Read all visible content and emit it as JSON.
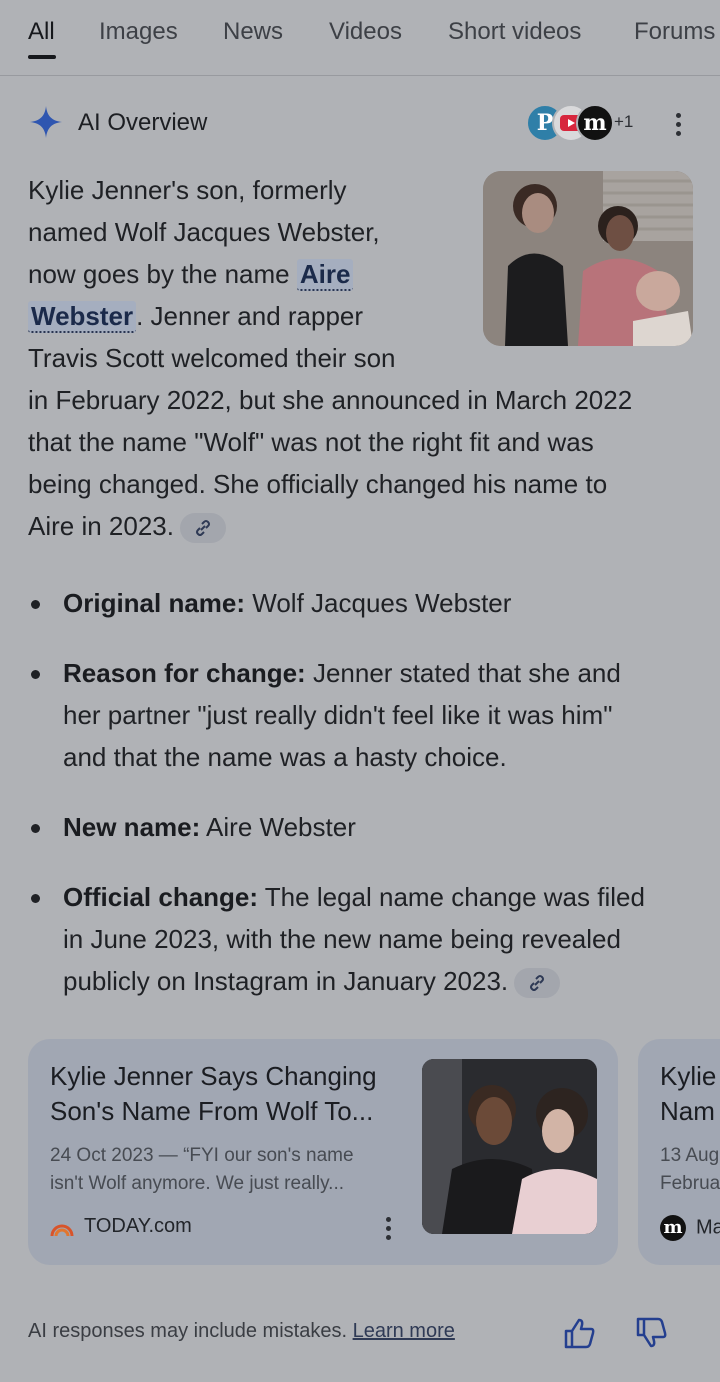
{
  "tabs": [
    {
      "label": "All",
      "active": true
    },
    {
      "label": "Images"
    },
    {
      "label": "News"
    },
    {
      "label": "Videos"
    },
    {
      "label": "Short videos"
    },
    {
      "label": "Forums"
    }
  ],
  "ai_overview": {
    "title": "AI Overview",
    "sources_more": "+1",
    "paragraph_lines": [
      "Kylie Jenner's son, formerly",
      "named Wolf Jacques Webster,",
      "now goes by the name ",
      "Aire",
      "Webster",
      ". Jenner and rapper",
      "Travis Scott welcomed their son",
      "in February 2022, but she announced in March 2022",
      "that the name \"Wolf\" was not the right fit and was",
      "being changed. She officially changed his name to",
      "Aire in 2023."
    ],
    "bullets": [
      {
        "label": "Original name:",
        "lines": [
          " Wolf Jacques Webster"
        ]
      },
      {
        "label": "Reason for change:",
        "lines": [
          " Jenner stated that she and",
          "her partner \"just really didn't feel like it was him\"",
          "and that the name was a hasty choice."
        ]
      },
      {
        "label": "New name:",
        "lines": [
          " Aire Webster"
        ]
      },
      {
        "label": "Official change:",
        "lines": [
          " The legal name change was filed",
          "in June 2023, with the new name being revealed",
          "publicly on Instagram in January 2023."
        ]
      }
    ]
  },
  "cards": [
    {
      "title_lines": [
        "Kylie Jenner Says Changing",
        "Son's Name From Wolf To..."
      ],
      "snippet_lines": [
        "24 Oct 2023 — “FYI our son's name",
        "isn't Wolf anymore. We just really..."
      ],
      "source": "TODAY.com"
    },
    {
      "title_lines": [
        "Kylie",
        "Nam"
      ],
      "snippet_lines": [
        "13 Aug",
        "Februa"
      ],
      "source": "Ma"
    }
  ],
  "footer": {
    "text": "AI responses may include mistakes.",
    "link": "Learn more"
  },
  "colors": {
    "accent": "#2f4a9a",
    "highlight": "#a5aebf"
  }
}
